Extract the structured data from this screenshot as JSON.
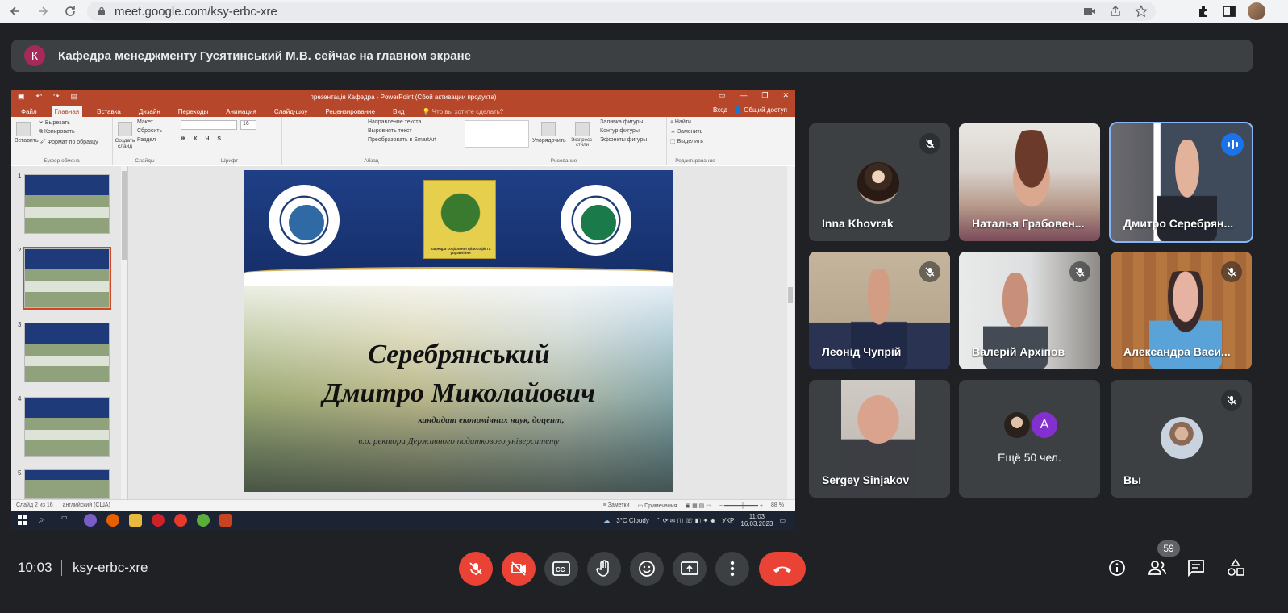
{
  "browser": {
    "url": "meet.google.com/ksy-erbc-xre"
  },
  "banner": {
    "initial": "К",
    "text": "Кафедра менеджменту Гусятинський М.В. сейчас на главном экране"
  },
  "powerpoint": {
    "title": "презентація Кафедра - PowerPoint (Сбой активации продукта)",
    "tabs": [
      "Файл",
      "Главная",
      "Вставка",
      "Дизайн",
      "Переходы",
      "Анимация",
      "Слайд-шоу",
      "Рецензирование",
      "Вид"
    ],
    "tell_me": "Что вы хотите сделать?",
    "sign_in": "Вход",
    "share": "Общий доступ",
    "ribbon": {
      "paste": "Вставить",
      "cut": "Вырезать",
      "copy": "Копировать",
      "format_painter": "Формат по образцу",
      "clipboard_group": "Буфер обмена",
      "new_slide": "Создать слайд",
      "layout": "Макет",
      "reset": "Сбросить",
      "section": "Раздел",
      "slides_group": "Слайды",
      "font_group": "Шрифт",
      "font_size": "16",
      "paragraph_group": "Абзац",
      "text_direction": "Направление текста",
      "align_text": "Выровнять текст",
      "smartart": "Преобразовать в SmartArt",
      "arrange": "Упорядочить",
      "quick_styles": "Экспресс-стили",
      "shape_fill": "Заливка фигуры",
      "shape_outline": "Контур фигуры",
      "shape_effects": "Эффекты фигуры",
      "drawing_group": "Рисование",
      "find": "Найти",
      "replace": "Заменить",
      "select": "Выделить",
      "editing_group": "Редактирование"
    },
    "thumb_numbers": [
      "1",
      "2",
      "3",
      "4",
      "5"
    ],
    "slide": {
      "logo_caption": "Кафедра соціальної філософії та управління",
      "name_line1": "Серебрянський",
      "name_line2": "Дмитро Миколайович",
      "sub1": "кандидат економічних наук, доцент,",
      "sub2": "в.о. ректора Державного податкового університету"
    },
    "status": {
      "slide_info": "Слайд 2 из 16",
      "language": "английский (США)",
      "notes": "Заметки",
      "comments": "Примечания",
      "zoom": "88 %"
    },
    "taskbar": {
      "weather": "3°C  Cloudy",
      "lang": "УКР",
      "time": "11:03",
      "date": "16.03.2023"
    }
  },
  "participants": [
    {
      "name": "Inna Khovrak",
      "muted": true
    },
    {
      "name": "Наталья Грабовен...",
      "muted": false
    },
    {
      "name": "Дмитро Серебрян...",
      "muted": false,
      "speaking": true
    },
    {
      "name": "Леонід Чупрій",
      "muted": true
    },
    {
      "name": "Валерій Архіпов",
      "muted": true
    },
    {
      "name": "Александра Васи...",
      "muted": true
    },
    {
      "name": "Sergey Sinjakov",
      "muted": false
    },
    {
      "name": "Ещё 50 чел.",
      "initial": "A"
    },
    {
      "name": "Вы",
      "muted": true
    }
  ],
  "bottom": {
    "time": "10:03",
    "meeting_code": "ksy-erbc-xre",
    "participant_count": "59"
  },
  "colors": {
    "background": "#202124",
    "tile": "#3c4043",
    "red": "#ea4335",
    "powerpoint": "#b7472a",
    "accent": "#1a73e8"
  }
}
